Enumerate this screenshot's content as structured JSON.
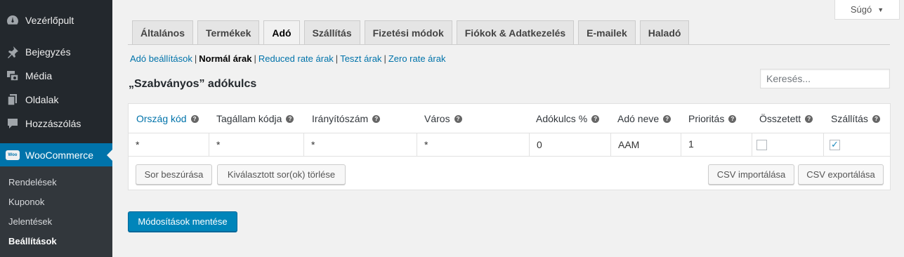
{
  "sidebar": {
    "items": [
      {
        "label": "Vezérlőpult",
        "icon": "dashboard-icon"
      },
      {
        "label": "Bejegyzés",
        "icon": "pin-icon"
      },
      {
        "label": "Média",
        "icon": "media-icon"
      },
      {
        "label": "Oldalak",
        "icon": "page-icon"
      },
      {
        "label": "Hozzászólás",
        "icon": "comment-icon"
      },
      {
        "label": "WooCommerce",
        "icon": "woocommerce-icon",
        "badge": "Woo"
      }
    ],
    "submenu": [
      "Rendelések",
      "Kuponok",
      "Jelentések",
      "Beállítások"
    ]
  },
  "help": {
    "label": "Súgó",
    "caret": "▼"
  },
  "tabs": [
    "Általános",
    "Termékek",
    "Adó",
    "Szállítás",
    "Fizetési módok",
    "Fiókok & Adatkezelés",
    "E-mailek",
    "Haladó"
  ],
  "subnav": {
    "items": [
      "Adó beállítások",
      "Normál árak",
      "Reduced rate árak",
      "Teszt árak",
      "Zero rate árak"
    ],
    "sep": "|"
  },
  "heading": "„Szabványos” adókulcs",
  "search": {
    "placeholder": "Keresés...",
    "value": ""
  },
  "table": {
    "headers": [
      "Ország kód",
      "Tagállam kódja",
      "Irányítószám",
      "Város",
      "Adókulcs %",
      "Adó neve",
      "Prioritás",
      "Összetett",
      "Szállítás"
    ],
    "help_glyph": "?",
    "row": {
      "country": "*",
      "state": "*",
      "postcode": "*",
      "city": "*",
      "rate": "0",
      "name": "AAM",
      "priority": "1",
      "compound": false,
      "shipping": true,
      "check_glyph": "✓"
    }
  },
  "buttons": {
    "insert": "Sor beszúrása",
    "delete": "Kiválasztott sor(ok) törlése",
    "import": "CSV importálása",
    "export": "CSV exportálása",
    "save": "Módosítások mentése"
  },
  "colors": {
    "accent": "#0073aa",
    "sidebar": "#23282d",
    "primary_button": "#0085ba"
  }
}
